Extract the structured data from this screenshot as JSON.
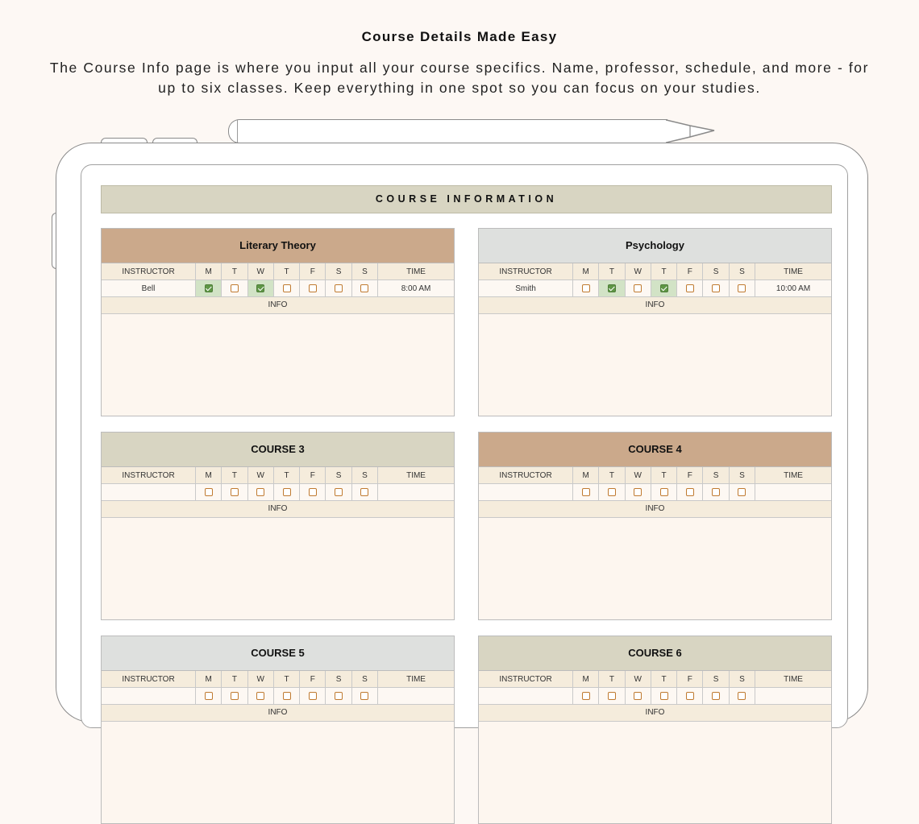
{
  "headline": "Course Details Made Easy",
  "description": "The Course Info page is where you input all your course specifics. Name, professor, schedule, and more - for up to six classes. Keep everything in one spot so you can focus on your studies.",
  "page_title": "COURSE INFORMATION",
  "columns": {
    "instructor": "INSTRUCTOR",
    "days": [
      "M",
      "T",
      "W",
      "T",
      "F",
      "S",
      "S"
    ],
    "time": "TIME",
    "info": "INFO"
  },
  "colors": {
    "tan": "#cba98b",
    "gray": "#dee0de",
    "olive": "#d8d5c2",
    "checked": "#5f9646",
    "checkbox": "#c07a30"
  },
  "courses": [
    {
      "title": "Literary Theory",
      "instructor": "Bell",
      "time": "8:00 AM",
      "checked": [
        true,
        false,
        true,
        false,
        false,
        false,
        false
      ],
      "color": "#cba98b"
    },
    {
      "title": "Psychology",
      "instructor": "Smith",
      "time": "10:00 AM",
      "checked": [
        false,
        true,
        false,
        true,
        false,
        false,
        false
      ],
      "color": "#dee0de"
    },
    {
      "title": "COURSE 3",
      "instructor": "",
      "time": "",
      "checked": [
        false,
        false,
        false,
        false,
        false,
        false,
        false
      ],
      "color": "#d8d5c2"
    },
    {
      "title": "COURSE 4",
      "instructor": "",
      "time": "",
      "checked": [
        false,
        false,
        false,
        false,
        false,
        false,
        false
      ],
      "color": "#cba98b"
    },
    {
      "title": "COURSE 5",
      "instructor": "",
      "time": "",
      "checked": [
        false,
        false,
        false,
        false,
        false,
        false,
        false
      ],
      "color": "#dee0de"
    },
    {
      "title": "COURSE 6",
      "instructor": "",
      "time": "",
      "checked": [
        false,
        false,
        false,
        false,
        false,
        false,
        false
      ],
      "color": "#d8d5c2"
    }
  ]
}
